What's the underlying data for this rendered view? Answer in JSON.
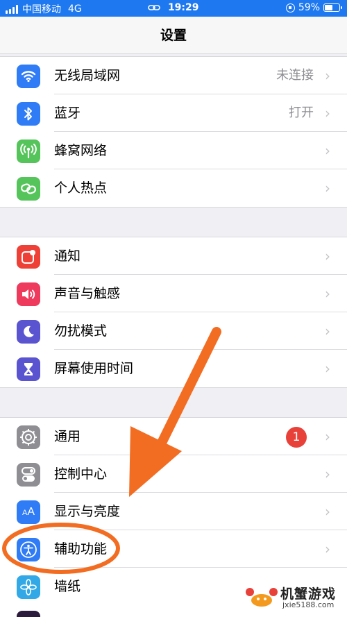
{
  "status_bar": {
    "carrier": "中国移动",
    "network": "4G",
    "time": "19:29",
    "battery_percent": "59%",
    "battery_level": 0.59
  },
  "nav": {
    "title": "设置"
  },
  "groups": [
    {
      "rows": [
        {
          "label": "无线局域网",
          "value": "未连接",
          "icon": "wifi-icon",
          "color": "#2f7cf6"
        },
        {
          "label": "蓝牙",
          "value": "打开",
          "icon": "bluetooth-icon",
          "color": "#2f7cf6"
        },
        {
          "label": "蜂窝网络",
          "value": "",
          "icon": "antenna-icon",
          "color": "#55c45a"
        },
        {
          "label": "个人热点",
          "value": "",
          "icon": "hotspot-link-icon",
          "color": "#55c45a"
        }
      ]
    },
    {
      "rows": [
        {
          "label": "通知",
          "value": "",
          "icon": "notification-icon",
          "color": "#ee4036"
        },
        {
          "label": "声音与触感",
          "value": "",
          "icon": "speaker-icon",
          "color": "#ee3a5c"
        },
        {
          "label": "勿扰模式",
          "value": "",
          "icon": "moon-icon",
          "color": "#5a54d1"
        },
        {
          "label": "屏幕使用时间",
          "value": "",
          "icon": "hourglass-icon",
          "color": "#5a54d1"
        }
      ]
    },
    {
      "rows": [
        {
          "label": "通用",
          "value": "",
          "badge": "1",
          "icon": "gear-icon",
          "color": "#8e8e93"
        },
        {
          "label": "控制中心",
          "value": "",
          "icon": "toggles-icon",
          "color": "#8e8e93"
        },
        {
          "label": "显示与亮度",
          "value": "",
          "icon": "text-size-icon",
          "color": "#2f7cf6"
        },
        {
          "label": "辅助功能",
          "value": "",
          "icon": "accessibility-icon",
          "color": "#2f7cf6"
        },
        {
          "label": "墙纸",
          "value": "",
          "icon": "flower-icon",
          "color": "#32a8e6"
        }
      ]
    }
  ],
  "annotation": {
    "color": "#f26d21"
  },
  "watermark": {
    "title": "机蟹游戏",
    "url": "jxie5188.com"
  }
}
